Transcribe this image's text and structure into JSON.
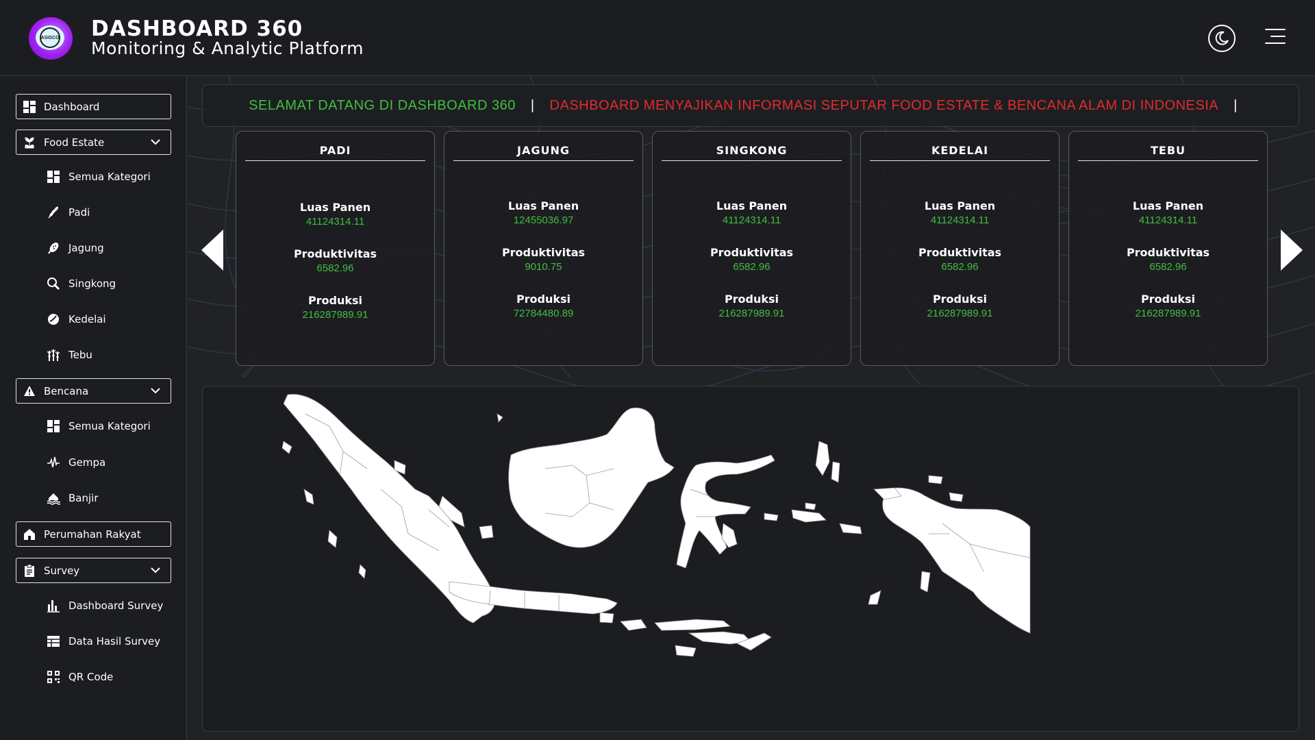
{
  "header": {
    "title": "DASHBOARD 360",
    "subtitle": "Monitoring & Analytic Platform",
    "logo_text": "ASISCO",
    "theme_icon": "moon-icon",
    "menu_icon": "menu-icon"
  },
  "sidebar": {
    "dashboard": "Dashboard",
    "food_estate": {
      "label": "Food Estate",
      "items": [
        "Semua Kategori",
        "Padi",
        "Jagung",
        "Singkong",
        "Kedelai",
        "Tebu"
      ]
    },
    "bencana": {
      "label": "Bencana",
      "items": [
        "Semua Kategori",
        "Gempa",
        "Banjir"
      ]
    },
    "perumahan": "Perumahan Rakyat",
    "survey": {
      "label": "Survey",
      "items": [
        "Dashboard Survey",
        "Data Hasil Survey",
        "QR Code"
      ]
    }
  },
  "ticker": {
    "welcome": "SELAMAT DATANG DI DASHBOARD 360",
    "sep": "|",
    "info": "DASHBOARD MENYAJIKAN INFORMASI SEPUTAR FOOD ESTATE & BENCANA ALAM DI INDONESIA"
  },
  "metric_labels": {
    "luas_panen": "Luas Panen",
    "produktivitas": "Produktivitas",
    "produksi": "Produksi"
  },
  "cards": [
    {
      "title": "PADI",
      "luas_panen": "41124314.11",
      "produktivitas": "6582.96",
      "produksi": "216287989.91"
    },
    {
      "title": "JAGUNG",
      "luas_panen": "12455036.97",
      "produktivitas": "9010.75",
      "produksi": "72784480.89"
    },
    {
      "title": "SINGKONG",
      "luas_panen": "41124314.11",
      "produktivitas": "6582.96",
      "produksi": "216287989.91"
    },
    {
      "title": "KEDELAI",
      "luas_panen": "41124314.11",
      "produktivitas": "6582.96",
      "produksi": "216287989.91"
    },
    {
      "title": "TEBU",
      "luas_panen": "41124314.11",
      "produktivitas": "6582.96",
      "produksi": "216287989.91"
    }
  ],
  "colors": {
    "accent_green": "#3fbf3f",
    "accent_red": "#e22b2b",
    "logo_purple": "#a020f0"
  }
}
